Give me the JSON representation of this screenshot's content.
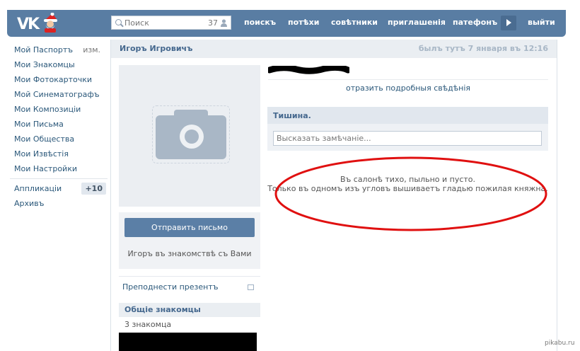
{
  "topbar": {
    "logo": "VK",
    "search": {
      "placeholder": "Поиск",
      "count": "37"
    },
    "nav": [
      "поискъ",
      "потѣхи",
      "совѣтники",
      "приглашенія",
      "патефонъ",
      "выйти"
    ]
  },
  "sidebar": {
    "edit_label": "изм.",
    "items": [
      "Мой Паспортъ",
      "Мои Знакомцы",
      "Мои Фотокарточки",
      "Мой Синематографъ",
      "Мои Композиціи",
      "Мои Письма",
      "Мои Общества",
      "Мои Извѣстія",
      "Мои Настройки"
    ],
    "extra": [
      {
        "label": "Аппликаціи",
        "badge": "+10"
      },
      {
        "label": "Архивъ"
      }
    ]
  },
  "profile": {
    "name": "Игоръ Игровичъ",
    "last_seen": "былъ тутъ 7 января въ 12:16",
    "send_message": "Отправить письмо",
    "friend_status": "Игоръ въ знакомствѣ съ Вами",
    "gift": "Преподнести презентъ",
    "mutual_title": "Общіе знакомцы",
    "mutual_count": "3 знакомца",
    "expand_info": "отразить подробныя свѣдѣнія"
  },
  "wall": {
    "title": "Тишина.",
    "input_placeholder": "Высказать замѣчаніе...",
    "empty_lines": [
      "Въ салонѣ тихо, пыльно и пусто.",
      "Только въ одномъ изъ угловъ вышиваетъ гладью пожилая княжна."
    ]
  },
  "watermark": "pikabu.ru",
  "colors": {
    "header": "#597da3",
    "link": "#2b587a",
    "title": "#45688e",
    "annotation": "#e01010"
  },
  "icons": [
    "search-icon",
    "person-icon",
    "play-icon",
    "camera-icon",
    "gift-icon",
    "santa-icon"
  ]
}
